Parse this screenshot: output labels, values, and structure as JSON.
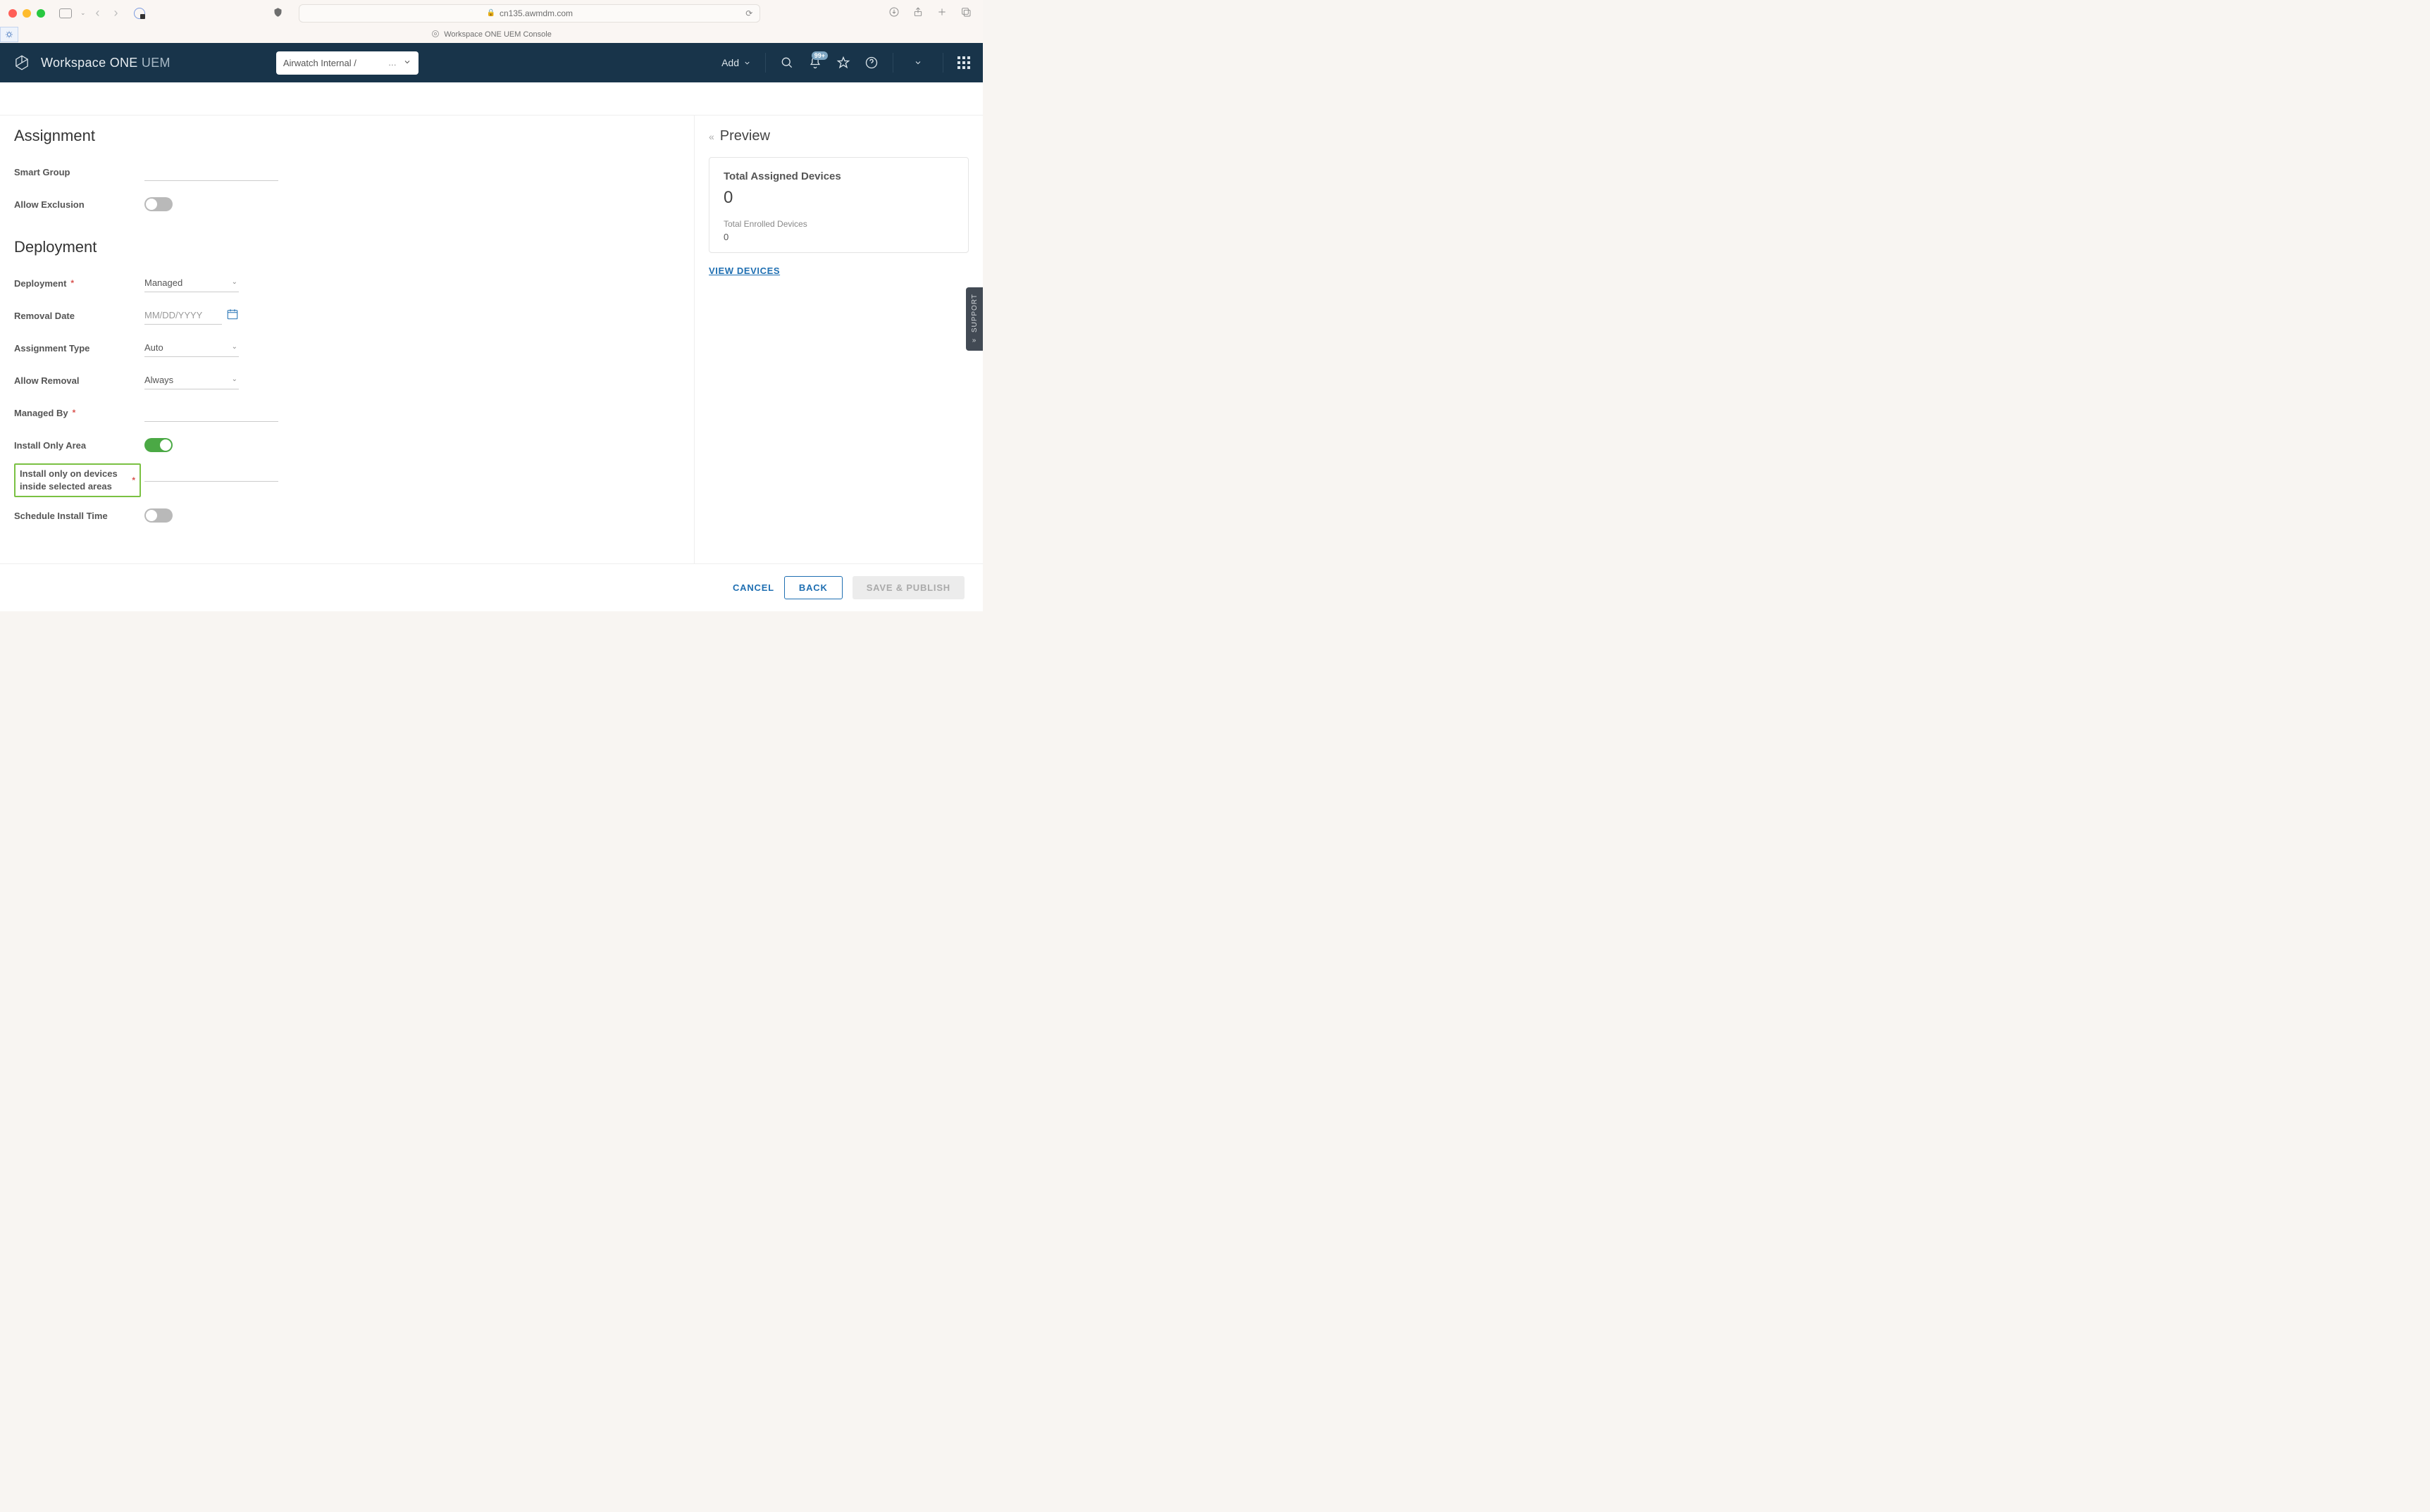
{
  "browser": {
    "url": "cn135.awmdm.com",
    "tab_title": "Workspace ONE UEM Console"
  },
  "header": {
    "product_name_1": "Workspace ONE",
    "product_name_2": "UEM",
    "org_picker": "Airwatch Internal /",
    "add_label": "Add",
    "notif_badge": "99+"
  },
  "sections": {
    "assignment_title": "Assignment",
    "deployment_title": "Deployment"
  },
  "form": {
    "smart_group_label": "Smart Group",
    "allow_exclusion_label": "Allow Exclusion",
    "allow_exclusion_on": false,
    "deployment_label": "Deployment",
    "deployment_value": "Managed",
    "removal_date_label": "Removal Date",
    "removal_date_placeholder": "MM/DD/YYYY",
    "assignment_type_label": "Assignment Type",
    "assignment_type_value": "Auto",
    "allow_removal_label": "Allow Removal",
    "allow_removal_value": "Always",
    "managed_by_label": "Managed By",
    "install_only_area_label": "Install Only Area",
    "install_only_area_on": true,
    "install_only_devices_label": "Install only on devices inside selected areas",
    "schedule_install_label": "Schedule Install Time",
    "schedule_install_on": false
  },
  "preview": {
    "title": "Preview",
    "card_title": "Total Assigned Devices",
    "card_value": "0",
    "sub_label": "Total Enrolled Devices",
    "sub_value": "0",
    "view_link": "VIEW DEVICES"
  },
  "support_tab": "SUPPORT",
  "footer": {
    "cancel": "CANCEL",
    "back": "BACK",
    "save": "SAVE & PUBLISH"
  }
}
